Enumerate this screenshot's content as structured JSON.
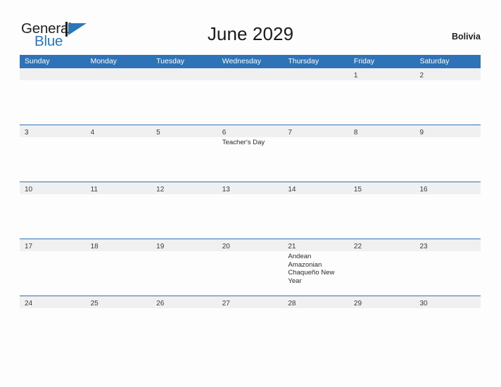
{
  "brand": {
    "line1": "General",
    "line2": "Blue",
    "accent_color": "#2b77bc",
    "text_color": "#231f20"
  },
  "header": {
    "title": "June 2029",
    "country": "Bolivia"
  },
  "calendar": {
    "header_bg": "#2e73b8",
    "header_text_color": "#ffffff",
    "date_band_bg": "#f0f0f0",
    "separator_color": "#2e73b8",
    "weekdays": [
      "Sunday",
      "Monday",
      "Tuesday",
      "Wednesday",
      "Thursday",
      "Friday",
      "Saturday"
    ],
    "weeks": [
      [
        {
          "date": "",
          "events": []
        },
        {
          "date": "",
          "events": []
        },
        {
          "date": "",
          "events": []
        },
        {
          "date": "",
          "events": []
        },
        {
          "date": "",
          "events": []
        },
        {
          "date": "1",
          "events": []
        },
        {
          "date": "2",
          "events": []
        }
      ],
      [
        {
          "date": "3",
          "events": []
        },
        {
          "date": "4",
          "events": []
        },
        {
          "date": "5",
          "events": []
        },
        {
          "date": "6",
          "events": [
            "Teacher's Day"
          ]
        },
        {
          "date": "7",
          "events": []
        },
        {
          "date": "8",
          "events": []
        },
        {
          "date": "9",
          "events": []
        }
      ],
      [
        {
          "date": "10",
          "events": []
        },
        {
          "date": "11",
          "events": []
        },
        {
          "date": "12",
          "events": []
        },
        {
          "date": "13",
          "events": []
        },
        {
          "date": "14",
          "events": []
        },
        {
          "date": "15",
          "events": []
        },
        {
          "date": "16",
          "events": []
        }
      ],
      [
        {
          "date": "17",
          "events": []
        },
        {
          "date": "18",
          "events": []
        },
        {
          "date": "19",
          "events": []
        },
        {
          "date": "20",
          "events": []
        },
        {
          "date": "21",
          "events": [
            "Andean Amazonian Chaqueño New Year"
          ]
        },
        {
          "date": "22",
          "events": []
        },
        {
          "date": "23",
          "events": []
        }
      ],
      [
        {
          "date": "24",
          "events": []
        },
        {
          "date": "25",
          "events": []
        },
        {
          "date": "26",
          "events": []
        },
        {
          "date": "27",
          "events": []
        },
        {
          "date": "28",
          "events": []
        },
        {
          "date": "29",
          "events": []
        },
        {
          "date": "30",
          "events": []
        }
      ]
    ]
  }
}
